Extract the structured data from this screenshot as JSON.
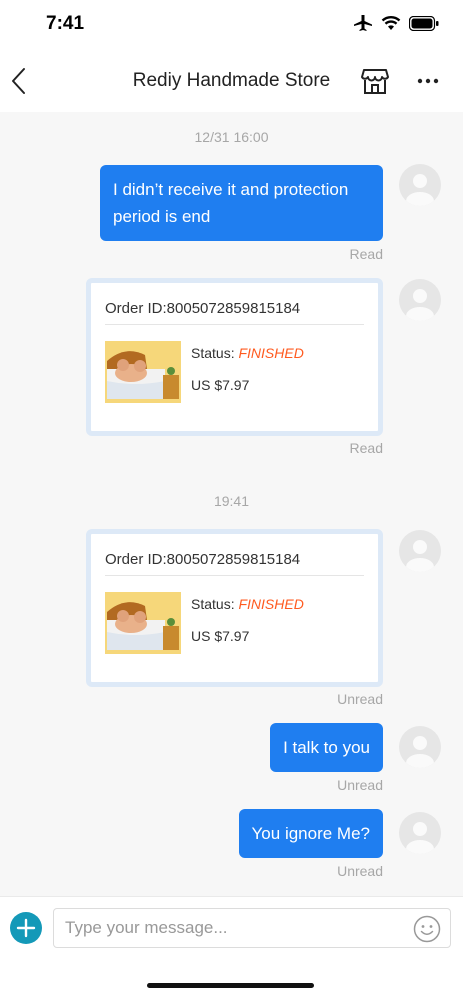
{
  "status_bar": {
    "time": "7:41"
  },
  "header": {
    "title": "Rediy Handmade Store"
  },
  "chat": {
    "timestamps": [
      "12/31 16:00",
      "19:41"
    ],
    "messages": [
      {
        "text": "I didn’t receive it and protection period is end",
        "status": "Read"
      },
      {
        "status": "Read",
        "order_id": "Order ID:8005072859815184",
        "status_label": "Status:",
        "status_value": "FINISHED",
        "price": "US $7.97"
      },
      {
        "status": "Unread",
        "order_id": "Order ID:8005072859815184",
        "status_label": "Status:",
        "status_value": "FINISHED",
        "price": "US $7.97"
      },
      {
        "text": "I talk to you",
        "status": "Unread"
      },
      {
        "text": "You ignore Me?",
        "status": "Unread"
      }
    ]
  },
  "input": {
    "placeholder": "Type your message..."
  },
  "colors": {
    "bubble": "#1f7ef0",
    "finished": "#ff5a1f",
    "plus": "#1499b8"
  },
  "icons": [
    "back-icon",
    "store-icon",
    "more-icon",
    "avatar-icon",
    "plus-icon",
    "emoji-icon",
    "airplane-icon",
    "wifi-icon",
    "battery-icon"
  ]
}
